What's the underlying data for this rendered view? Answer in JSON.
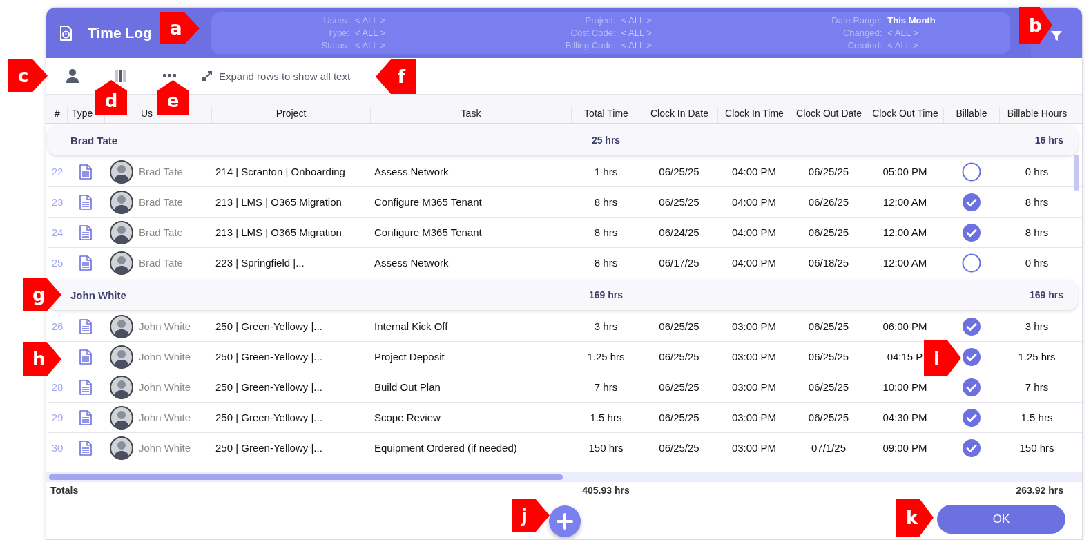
{
  "header": {
    "title": "Time Log",
    "filter_columns": [
      {
        "filters": [
          {
            "label": "Users:",
            "value": "< ALL >",
            "active": false
          },
          {
            "label": "Type:",
            "value": "< ALL >",
            "active": false
          },
          {
            "label": "Status:",
            "value": "< ALL >",
            "active": false
          }
        ]
      },
      {
        "filters": [
          {
            "label": "Project:",
            "value": "< ALL >",
            "active": false
          },
          {
            "label": "Cost Code:",
            "value": "< ALL >",
            "active": false
          },
          {
            "label": "Billing Code:",
            "value": "< ALL >",
            "active": false
          }
        ]
      },
      {
        "filters": [
          {
            "label": "Date Range:",
            "value": "This Month",
            "active": true
          },
          {
            "label": "Changed:",
            "value": "< ALL >",
            "active": false
          },
          {
            "label": "Created:",
            "value": "< ALL >",
            "active": false
          }
        ]
      }
    ]
  },
  "toolbar": {
    "expand_link": "Expand rows to show all text"
  },
  "table": {
    "columns": [
      "#",
      "Type",
      "Us",
      "Project",
      "Task",
      "Total Time",
      "Clock In Date",
      "Clock In Time",
      "Clock Out Date",
      "Clock Out Time",
      "Billable",
      "Billable Hours"
    ],
    "groups": [
      {
        "name": "Brad Tate",
        "total_time": "25 hrs",
        "billable_hours": "16 hrs",
        "rows": [
          {
            "number": "22",
            "user": "Brad Tate",
            "project": "214 | Scranton | Onboarding",
            "task": "Assess Network",
            "total_time": "1 hrs",
            "clock_in_date": "06/25/25",
            "clock_in_time": "04:00 PM",
            "clock_out_date": "06/25/25",
            "clock_out_time": "05:00 PM",
            "billable": false,
            "billable_hours": "0 hrs"
          },
          {
            "number": "23",
            "user": "Brad Tate",
            "project": "213 | LMS | O365 Migration",
            "task": "Configure M365 Tenant",
            "total_time": "8 hrs",
            "clock_in_date": "06/25/25",
            "clock_in_time": "04:00 PM",
            "clock_out_date": "06/26/25",
            "clock_out_time": "12:00 AM",
            "billable": true,
            "billable_hours": "8 hrs"
          },
          {
            "number": "24",
            "user": "Brad Tate",
            "project": "213 | LMS | O365 Migration",
            "task": "Configure M365 Tenant",
            "total_time": "8 hrs",
            "clock_in_date": "06/24/25",
            "clock_in_time": "04:00 PM",
            "clock_out_date": "06/25/25",
            "clock_out_time": "12:00 AM",
            "billable": true,
            "billable_hours": "8 hrs"
          },
          {
            "number": "25",
            "user": "Brad Tate",
            "project": "223 | Springfield |...",
            "task": "Assess Network",
            "total_time": "8 hrs",
            "clock_in_date": "06/17/25",
            "clock_in_time": "04:00 PM",
            "clock_out_date": "06/18/25",
            "clock_out_time": "12:00 AM",
            "billable": false,
            "billable_hours": "0 hrs"
          }
        ]
      },
      {
        "name": "John White",
        "total_time": "169 hrs",
        "billable_hours": "169 hrs",
        "rows": [
          {
            "number": "26",
            "user": "John White",
            "project": "250 | Green-Yellowy |...",
            "task": "Internal Kick Off",
            "total_time": "3 hrs",
            "clock_in_date": "06/25/25",
            "clock_in_time": "03:00 PM",
            "clock_out_date": "06/25/25",
            "clock_out_time": "06:00 PM",
            "billable": true,
            "billable_hours": "3 hrs"
          },
          {
            "user": "John White",
            "project": "250 | Green-Yellowy |...",
            "task": "Project Deposit",
            "total_time": "1.25 hrs",
            "clock_in_date": "06/25/25",
            "clock_in_time": "03:00 PM",
            "clock_out_date": "06/25/25",
            "clock_out_time": "04:15 P",
            "billable": true,
            "billable_hours": "1.25 hrs"
          },
          {
            "number": "28",
            "user": "John White",
            "project": "250 | Green-Yellowy |...",
            "task": "Build Out Plan",
            "total_time": "7 hrs",
            "clock_in_date": "06/25/25",
            "clock_in_time": "03:00 PM",
            "clock_out_date": "06/25/25",
            "clock_out_time": "10:00 PM",
            "billable": true,
            "billable_hours": "7 hrs"
          },
          {
            "number": "29",
            "user": "John White",
            "project": "250 | Green-Yellowy |...",
            "task": "Scope Review",
            "total_time": "1.5 hrs",
            "clock_in_date": "06/25/25",
            "clock_in_time": "03:00 PM",
            "clock_out_date": "06/25/25",
            "clock_out_time": "04:30 PM",
            "billable": true,
            "billable_hours": "1.5 hrs"
          },
          {
            "number": "30",
            "user": "John White",
            "project": "250 | Green-Yellowy |...",
            "task": "Equipment Ordered (if needed)",
            "total_time": "150 hrs",
            "clock_in_date": "06/25/25",
            "clock_in_time": "03:00 PM",
            "clock_out_date": "07/1/25",
            "clock_out_time": "09:00 PM",
            "billable": true,
            "billable_hours": "150 hrs"
          }
        ]
      }
    ],
    "totals": {
      "label": "Totals",
      "total_time": "405.93 hrs",
      "billable_hours": "263.92 hrs"
    }
  },
  "footer": {
    "ok_button": "OK"
  },
  "callouts": [
    {
      "label": "a",
      "kind": "right"
    },
    {
      "label": "b",
      "kind": "right"
    },
    {
      "label": "c",
      "kind": "right"
    },
    {
      "label": "d",
      "kind": "up"
    },
    {
      "label": "e",
      "kind": "up"
    },
    {
      "label": "f",
      "kind": "left"
    },
    {
      "label": "g",
      "kind": "right"
    },
    {
      "label": "h",
      "kind": "right"
    },
    {
      "label": "i",
      "kind": "right"
    },
    {
      "label": "j",
      "kind": "right"
    },
    {
      "label": "k",
      "kind": "right"
    }
  ]
}
